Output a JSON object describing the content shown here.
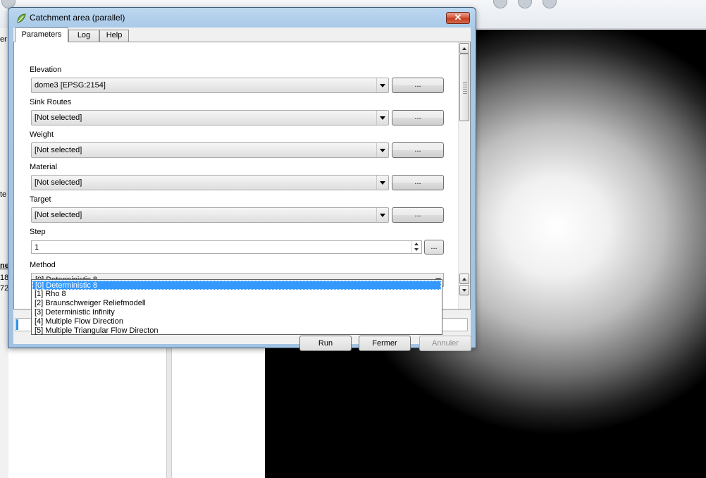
{
  "background": {
    "side_texts": [
      "er",
      "te",
      "ne",
      "18",
      "72"
    ]
  },
  "dialog": {
    "title": "Catchment area (parallel)",
    "close_glyph": "✕",
    "tabs": [
      {
        "label": "Parameters",
        "active": true
      },
      {
        "label": "Log",
        "active": false
      },
      {
        "label": "Help",
        "active": false
      }
    ],
    "params": [
      {
        "label": "Elevation",
        "value": "dome3 [EPSG:2154]",
        "button": "..."
      },
      {
        "label": "Sink Routes",
        "value": "[Not selected]",
        "button": "..."
      },
      {
        "label": "Weight",
        "value": "[Not selected]",
        "button": "..."
      },
      {
        "label": "Material",
        "value": "[Not selected]",
        "button": "..."
      },
      {
        "label": "Target",
        "value": "[Not selected]",
        "button": "..."
      }
    ],
    "step": {
      "label": "Step",
      "value": "1",
      "button": "..."
    },
    "method": {
      "label": "Method",
      "value": "[0] Deterministic 8",
      "options": [
        "[0] Deterministic 8",
        "[1] Rho 8",
        "[2] Braunschweiger Reliefmodell",
        "[3] Deterministic Infinity",
        "[4] Multiple Flow Direction",
        "[5] Multiple Triangular Flow Directon"
      ],
      "selected_index": 0
    },
    "progress_fraction": 0.005,
    "buttons": {
      "run": "Run",
      "close": "Fermer",
      "cancel": "Annuler"
    }
  },
  "colors": {
    "selection": "#3399ff",
    "progress": "#2f8ee7",
    "close_button": "#c33b20"
  }
}
